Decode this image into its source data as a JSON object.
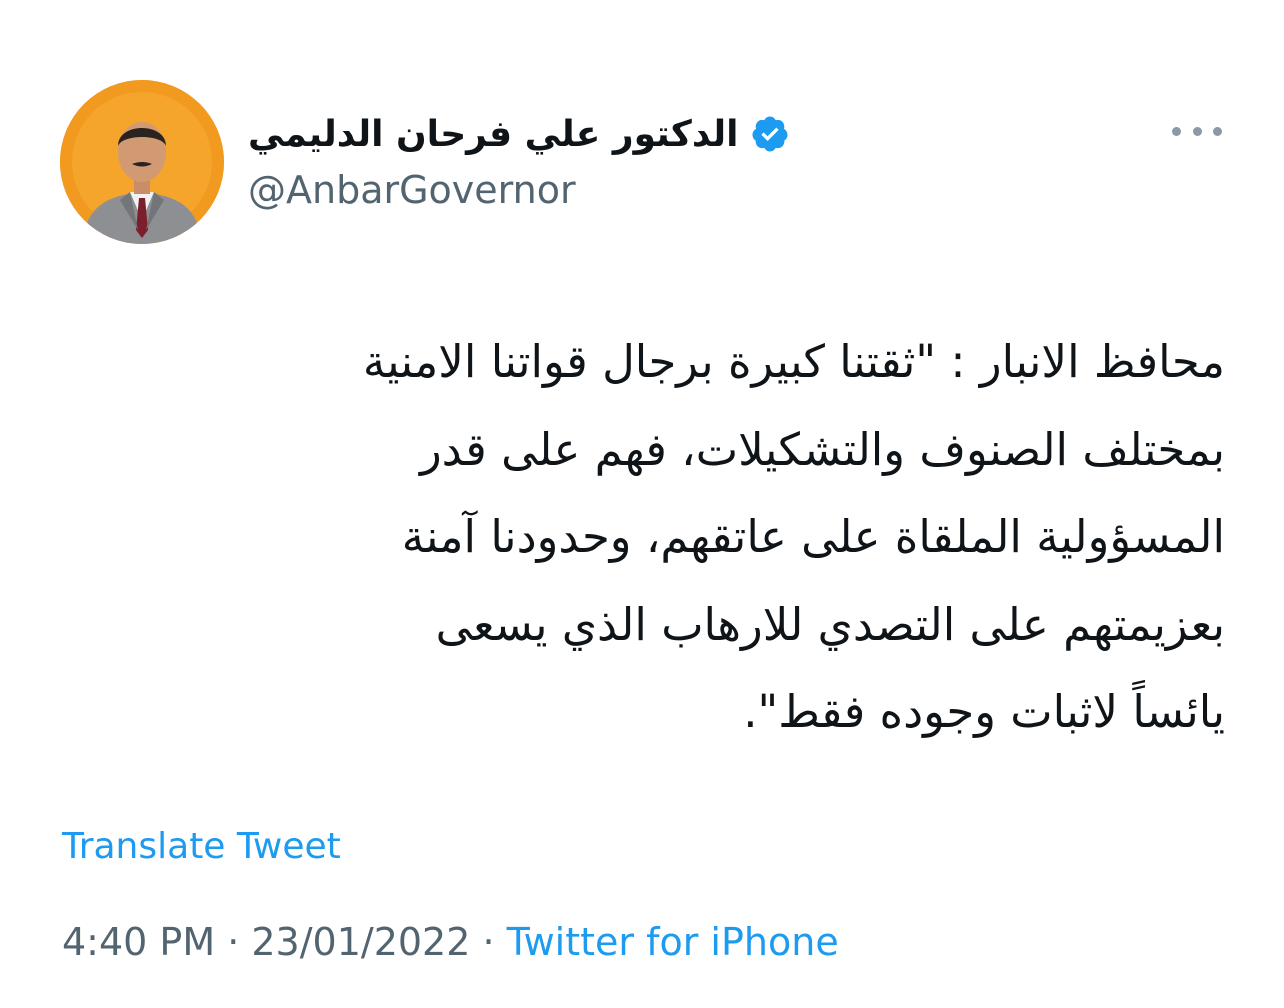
{
  "author": {
    "display_name": "الدكتور علي فرحان الدليمي",
    "handle": "@AnbarGovernor",
    "verified_icon": "verified-badge-icon",
    "avatar_bg": "#f29a1f"
  },
  "tweet": {
    "lines": [
      "محافظ الانبار : \"ثقتنا كبيرة برجال قواتنا الامنية",
      "بمختلف الصنوف والتشكيلات، فهم على قدر",
      "المسؤولية الملقاة على عاتقهم، وحدودنا آمنة",
      "بعزيمتهم على التصدي للارهاب الذي يسعى",
      "يائساً لاثبات وجوده فقط\"."
    ]
  },
  "translate_label": "Translate Tweet",
  "meta": {
    "time": "4:40 PM",
    "separator": " · ",
    "date": "23/01/2022",
    "source": "Twitter for iPhone"
  },
  "colors": {
    "link": "#1d9bf0",
    "secondary": "#536471",
    "text": "#0f1419"
  }
}
